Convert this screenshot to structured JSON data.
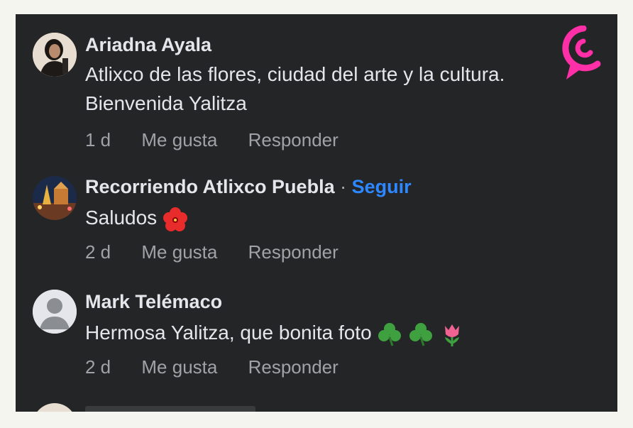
{
  "comments": [
    {
      "author": "Ariadna Ayala",
      "lines": [
        "Atlixco de las flores, ciudad del arte y la cultura.",
        "Bienvenida Yalitza"
      ],
      "time": "1 d",
      "like": "Me gusta",
      "reply": "Responder"
    },
    {
      "author": "Recorriendo Atlixco Puebla",
      "separator": "·",
      "follow": "Seguir",
      "text": "Saludos",
      "emoji": "hibiscus",
      "time": "2 d",
      "like": "Me gusta",
      "reply": "Responder"
    },
    {
      "author": "Mark Telémaco",
      "text": "Hermosa Yalitza, que bonita foto",
      "emoji": [
        "shamrock",
        "shamrock",
        "tulip"
      ],
      "time": "2 d",
      "like": "Me gusta",
      "reply": "Responder"
    }
  ],
  "colors": {
    "panel_bg": "#242526",
    "text": "#e4e6eb",
    "muted": "#9fa2a7",
    "follow": "#2d88ff",
    "logo": "#ff2fa8"
  },
  "icons": {
    "logo": "pink-c-logo",
    "default_avatar": "person-silhouette-icon"
  }
}
